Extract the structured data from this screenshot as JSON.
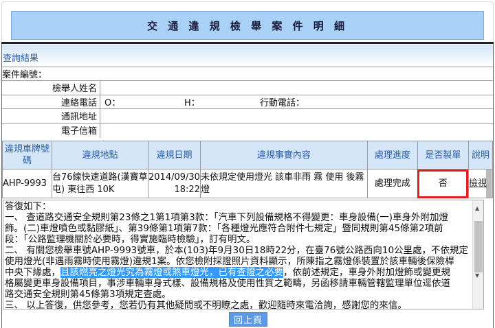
{
  "title": "交 通 違 規 檢 舉 案 件 明 細",
  "section": "查詢結果",
  "case_no_label": "案件編號：",
  "fields": {
    "name": "檢舉人姓名",
    "phone": "連絡電話",
    "phone_o": "O：",
    "phone_h": "H：",
    "mobile": "行動電話：",
    "address": "通訊地址",
    "email": "電子信箱"
  },
  "table": {
    "headers": [
      "違規車牌號碼",
      "違規地點",
      "違規日期",
      "違規事實內容",
      "處理進度",
      "是否製單",
      "說明"
    ],
    "row": {
      "plate": "AHP-9993",
      "location": "台76線快速道路(漢寶草屯) 東往西 10K",
      "date": "2014/09/30",
      "time": "18:22",
      "fact": "未依規定使用燈光 該車非雨 霧 使用 後霧燈",
      "status": "處理完成",
      "ticket": "否",
      "view": "檢視"
    }
  },
  "reply": {
    "lines": [
      "答復如下：",
      "一、 查道路交通安全規則第23條之1第1項第3款：「汽車下列設備規格不得變更：車身設備(一)車身外附加燈",
      "飾。(二)車燈噴色或黏膠紙」、第39條第1項第7款：「各種燈光應符合附件七規定」暨同規則第45條第2項前",
      "段：「公路監理機關於必要時，得實施臨時檢驗」，訂有明文。",
      "二、 有關您檢舉車號AHP-9993號車，於本(103)年9月30日18時22分，在臺76號公路西向10公里處，不依規定",
      "使用燈光(非遇雨霧時使用霧燈)違規1案。依您檢附採證照片資料顯示，所陳指之霧燈係裝置於該車輛後保險桿"
    ],
    "line7_pre": "中央下緣處，",
    "line7_sel": "且該燃亮之燈光究為霧燈或煞車燈光，已有查證之必要",
    "line7_post": "，依前述規定，車身外附加燈飾或變更規",
    "lines_after": [
      "格屬變更車身設備項目，事涉車輛車身式樣、設備規格及使用性質之範疇，另函移請車輛管轄監理單位逕依道",
      "路交通安全規則第45條第3項規定查處。",
      "三、 以上答復，供您參考，您若仍有其他疑問或不明瞭之處，歡迎隨時來電洽詢，感謝您的來信。"
    ]
  },
  "back_button": "回上頁"
}
